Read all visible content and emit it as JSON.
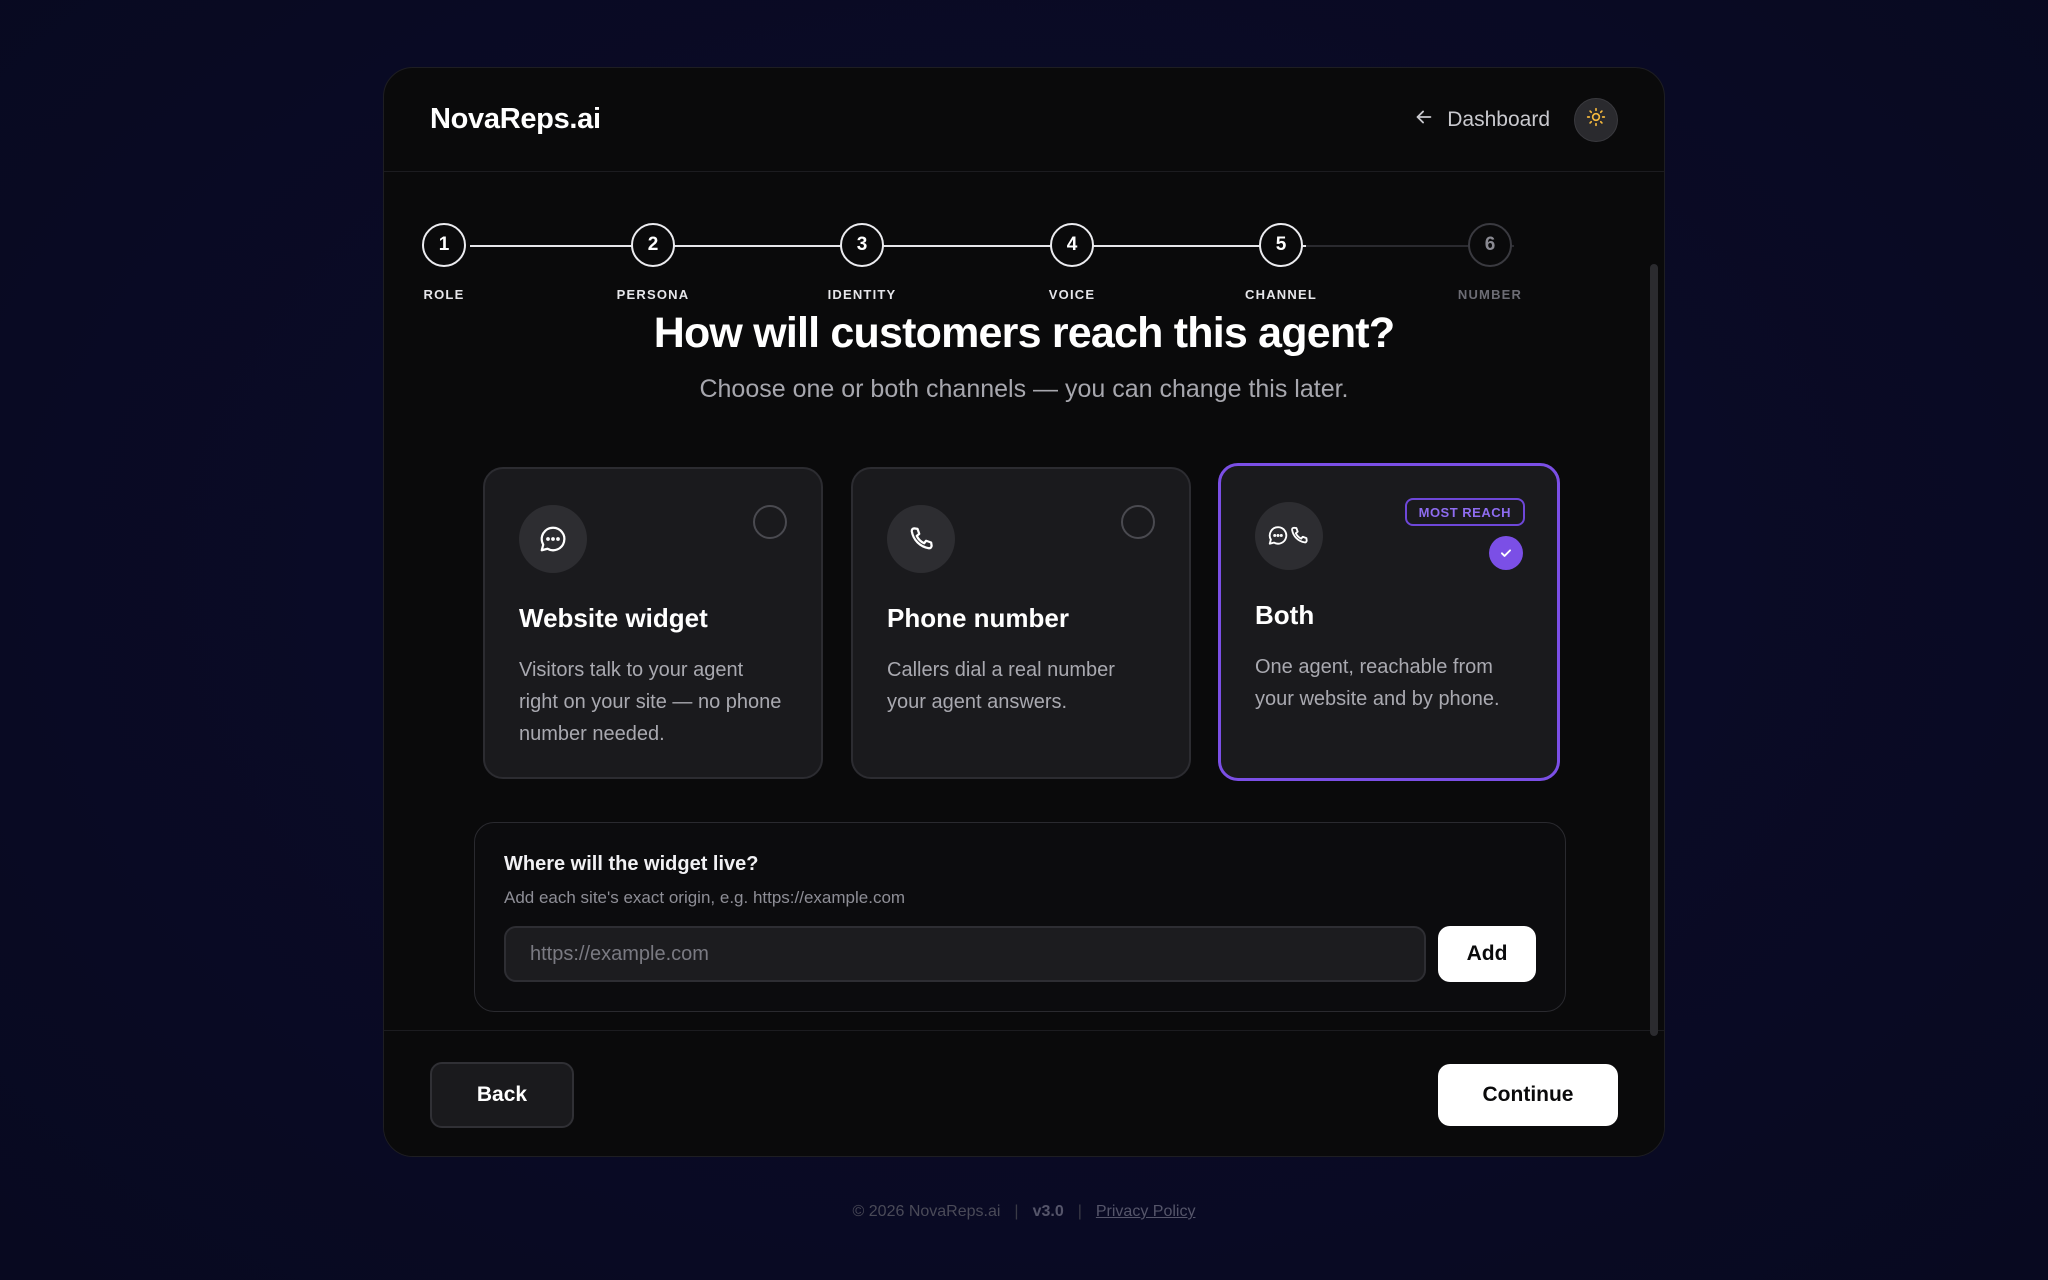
{
  "header": {
    "logo": "NovaReps.ai",
    "dashboard_label": "Dashboard"
  },
  "stepper": {
    "steps": [
      {
        "number": "1",
        "label": "ROLE",
        "state": "done"
      },
      {
        "number": "2",
        "label": "PERSONA",
        "state": "done"
      },
      {
        "number": "3",
        "label": "IDENTITY",
        "state": "done"
      },
      {
        "number": "4",
        "label": "VOICE",
        "state": "done"
      },
      {
        "number": "5",
        "label": "CHANNEL",
        "state": "current"
      },
      {
        "number": "6",
        "label": "NUMBER",
        "state": "upcoming"
      }
    ]
  },
  "main": {
    "title": "How will customers reach this agent?",
    "subtitle": "Choose one or both channels — you can change this later."
  },
  "options": [
    {
      "title": "Website widget",
      "description": "Visitors talk to your agent right on your site — no phone number needed.",
      "selected": false,
      "icon": "chat-icon"
    },
    {
      "title": "Phone number",
      "description": "Callers dial a real number your agent answers.",
      "selected": false,
      "icon": "phone-icon"
    },
    {
      "title": "Both",
      "description": "One agent, reachable from your website and by phone.",
      "selected": true,
      "badge": "MOST REACH",
      "icon": "chat-phone-icon"
    }
  ],
  "widget": {
    "title": "Where will the widget live?",
    "hint": "Add each site's exact origin, e.g. https://example.com",
    "placeholder": "https://example.com",
    "value": "",
    "add_label": "Add"
  },
  "footer_actions": {
    "back_label": "Back",
    "continue_label": "Continue"
  },
  "site_footer": {
    "copyright": "© 2026 NovaReps.ai",
    "version": "v3.0",
    "privacy": "Privacy Policy"
  },
  "colors": {
    "accent": "#7b4fe6",
    "sun": "#f5b83d",
    "background": "#0a0b26"
  }
}
